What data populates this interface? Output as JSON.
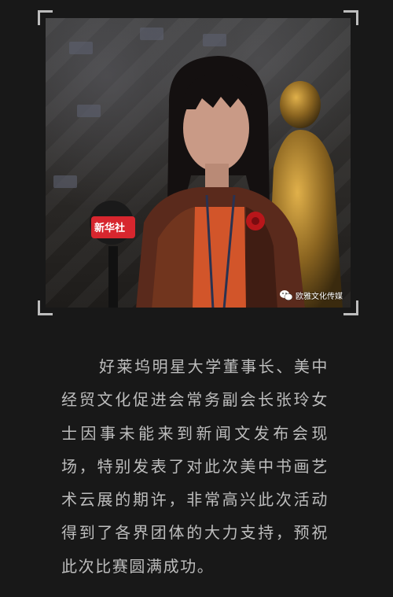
{
  "photo": {
    "mic_flag_text": "新华社",
    "watermark": {
      "icon": "wechat-icon",
      "text": "欧雅文化传媒"
    }
  },
  "article": {
    "paragraph": "好莱坞明星大学董事长、美中经贸文化促进会常务副会长张玲女士因事未能来到新闻文发布会现场，特别发表了对此次美中书画艺术云展的期许，非常高兴此次活动得到了各界团体的大力支持，预祝此次比赛圆满成功。"
  },
  "colors": {
    "background": "#181818",
    "text": "#bdbdbd",
    "frame_corners": "#bdbdbd",
    "mic_flag": "#d7262e"
  }
}
